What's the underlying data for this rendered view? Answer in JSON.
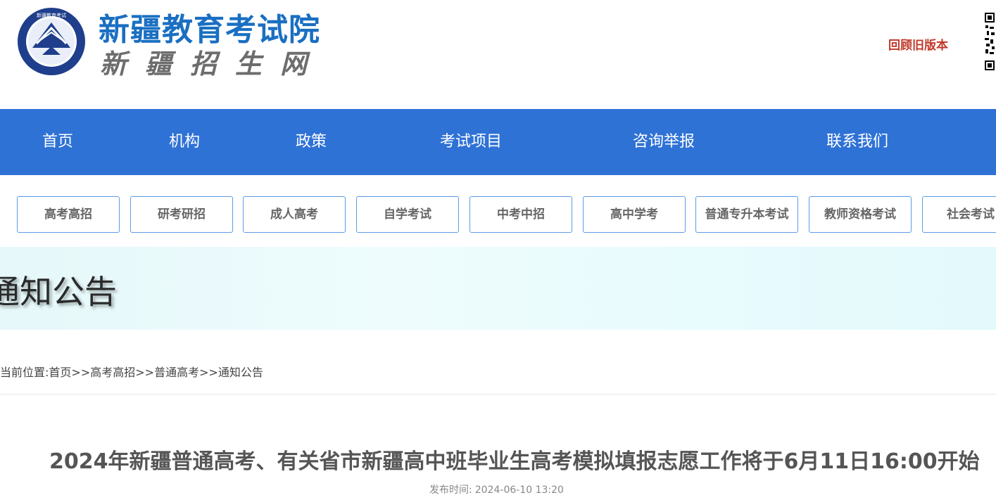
{
  "header": {
    "site_title": "新疆教育考试院",
    "site_subtitle": "新疆招生网",
    "emblem_text": "新疆教育考试",
    "old_version_link": "回顾旧版本",
    "brand_color": "#1a6fc2"
  },
  "nav": {
    "items": [
      {
        "label": "首页"
      },
      {
        "label": "机构"
      },
      {
        "label": "政策"
      },
      {
        "label": "考试项目"
      },
      {
        "label": "咨询举报"
      },
      {
        "label": "联系我们"
      }
    ],
    "background": "#2f72d6"
  },
  "categories": [
    {
      "label": "高考高招"
    },
    {
      "label": "研考研招"
    },
    {
      "label": "成人高考"
    },
    {
      "label": "自学考试"
    },
    {
      "label": "中考中招"
    },
    {
      "label": "高中学考"
    },
    {
      "label": "普通专升本考试"
    },
    {
      "label": "教师资格考试"
    },
    {
      "label": "社会考试"
    }
  ],
  "banner": {
    "title": "通知公告"
  },
  "breadcrumb": {
    "prefix": "当前位置:",
    "items": [
      "首页",
      "高考高招",
      "普通高考",
      "通知公告"
    ],
    "separator": ">>"
  },
  "article": {
    "title": "2024年新疆普通高考、有关省市新疆高中班毕业生高考模拟填报志愿工作将于6月11日16:00开始",
    "published_label": "发布时间:",
    "published_at": "2024-06-10 13:20"
  }
}
